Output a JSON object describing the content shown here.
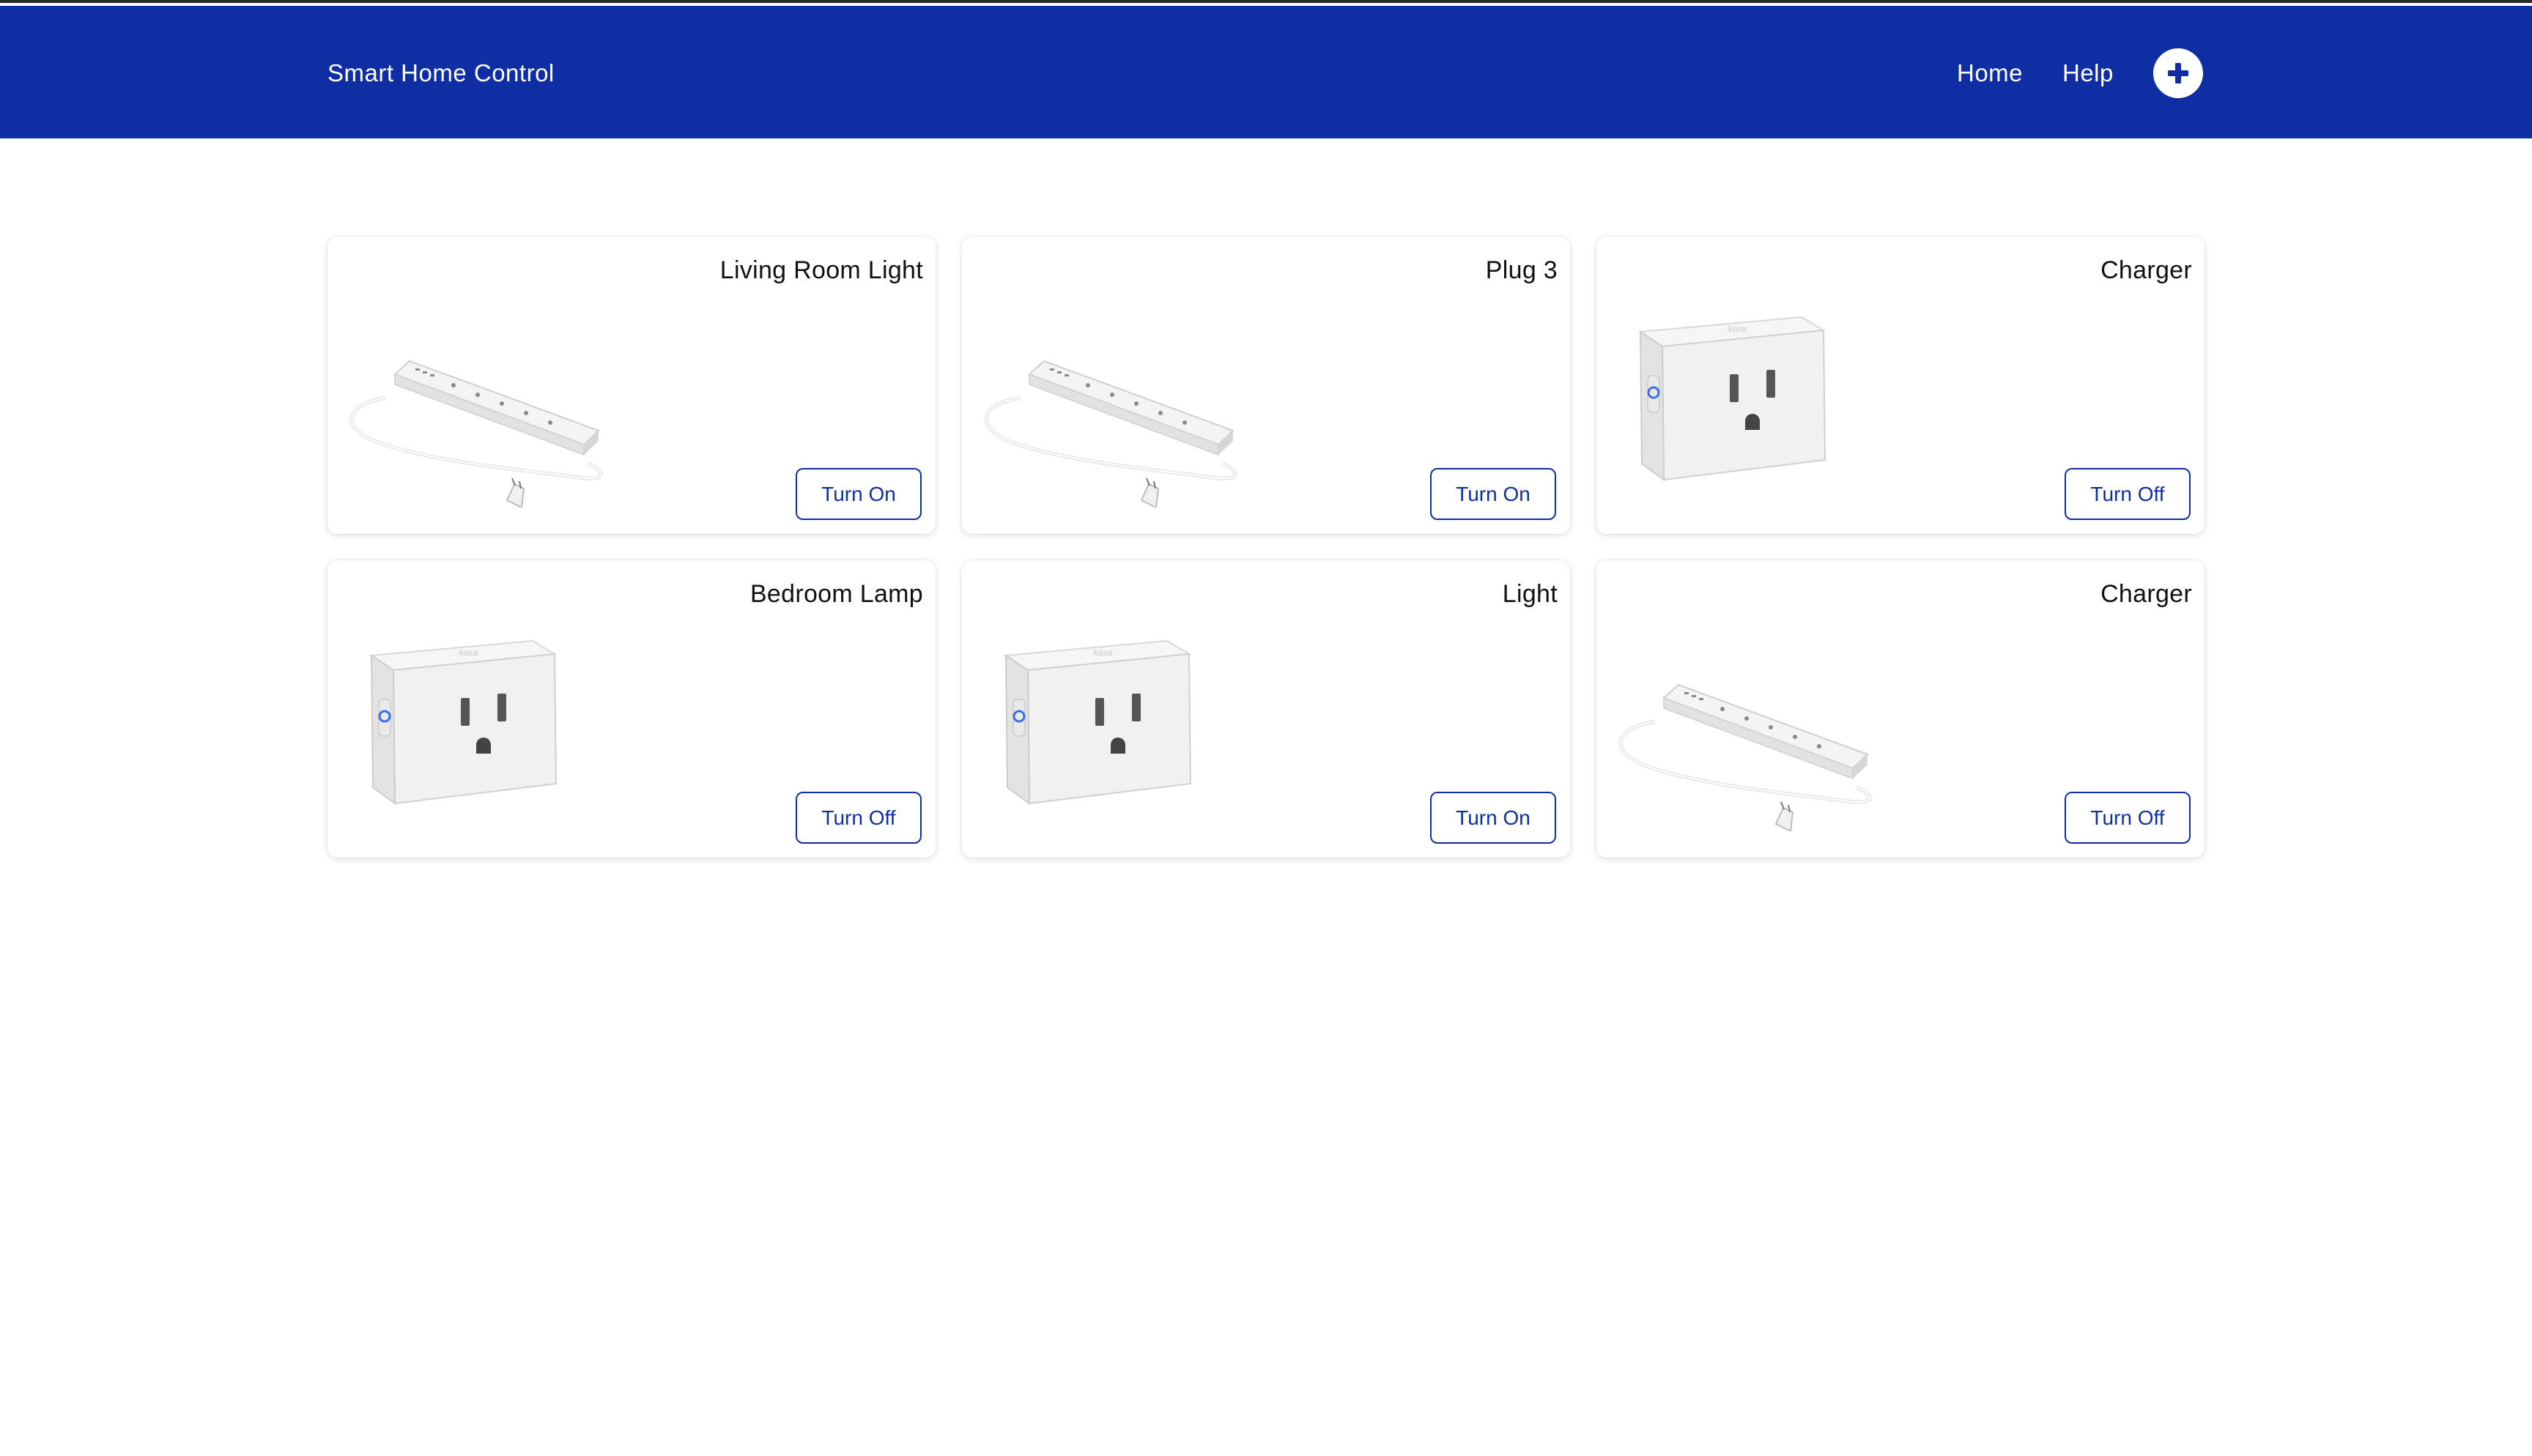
{
  "app": {
    "title": "Smart Home Control"
  },
  "nav": {
    "home_label": "Home",
    "help_label": "Help",
    "add_icon": "plus-icon"
  },
  "devices": [
    {
      "name": "Living Room Light",
      "button_label": "Turn On",
      "device_type": "power-strip"
    },
    {
      "name": "Plug 3",
      "button_label": "Turn On",
      "device_type": "power-strip"
    },
    {
      "name": "Charger",
      "button_label": "Turn Off",
      "device_type": "smart-plug"
    },
    {
      "name": "Bedroom Lamp",
      "button_label": "Turn Off",
      "device_type": "smart-plug"
    },
    {
      "name": "Light",
      "button_label": "Turn On",
      "device_type": "smart-plug"
    },
    {
      "name": "Charger",
      "button_label": "Turn Off",
      "device_type": "power-strip"
    }
  ],
  "colors": {
    "brand": "#0f2ea3",
    "background": "#ffffff",
    "card": "#ffffff"
  }
}
